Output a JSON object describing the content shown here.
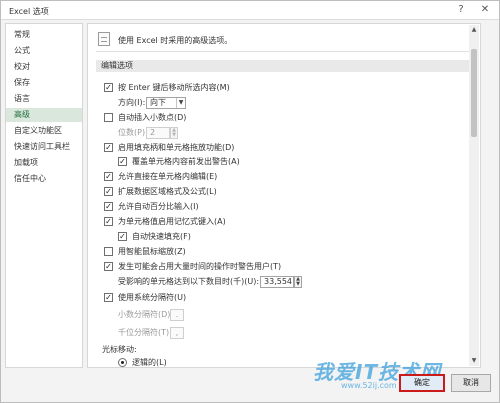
{
  "window": {
    "title": "Excel 选项",
    "help_label": "?",
    "close_label": "✕"
  },
  "sidebar": {
    "items": [
      {
        "label": "常规"
      },
      {
        "label": "公式"
      },
      {
        "label": "校对"
      },
      {
        "label": "保存"
      },
      {
        "label": "语言"
      },
      {
        "label": "高级"
      },
      {
        "label": "自定义功能区"
      },
      {
        "label": "快速访问工具栏"
      },
      {
        "label": "加载项"
      },
      {
        "label": "信任中心"
      }
    ],
    "active_index": 5
  },
  "content": {
    "header_text": "使用 Excel 时采用的高级选项。",
    "section_title": "编辑选项",
    "options": [
      {
        "label": "按 Enter 键后移动所选内容(M)",
        "checked": true,
        "enabled": true
      },
      {
        "label": "方向(I):",
        "enabled": true
      },
      {
        "label": "自动插入小数点(D)",
        "checked": false,
        "enabled": true
      },
      {
        "label": "位数(P):",
        "enabled": false
      },
      {
        "label": "启用填充柄和单元格拖放功能(D)",
        "checked": true,
        "enabled": true
      },
      {
        "label": "覆盖单元格内容前发出警告(A)",
        "checked": true,
        "enabled": true
      },
      {
        "label": "允许直接在单元格内编辑(E)",
        "checked": true,
        "enabled": true
      },
      {
        "label": "扩展数据区域格式及公式(L)",
        "checked": true,
        "enabled": true
      },
      {
        "label": "允许自动百分比输入(I)",
        "checked": true,
        "enabled": true
      },
      {
        "label": "为单元格值启用记忆式键入(A)",
        "checked": true,
        "enabled": true
      },
      {
        "label": "自动快速填充(F)",
        "checked": true,
        "enabled": true
      },
      {
        "label": "用智能鼠标缩放(Z)",
        "checked": false,
        "enabled": true
      },
      {
        "label": "发生可能会占用大量时间的操作时警告用户(T)",
        "checked": true,
        "enabled": true
      },
      {
        "label": "受影响的单元格达到以下数目时(千)(U):",
        "enabled": true
      },
      {
        "label": "使用系统分隔符(U)",
        "checked": true,
        "enabled": true
      },
      {
        "label": "小数分隔符(D):",
        "enabled": false
      },
      {
        "label": "千位分隔符(T):",
        "enabled": false
      },
      {
        "label": "光标移动:",
        "enabled": true
      },
      {
        "label": "逻辑的(L)",
        "enabled": true
      }
    ],
    "direction_value": "向下",
    "places_value": "2",
    "cells_threshold_value": "33,554",
    "decimal_separator_value": ".",
    "thousands_separator_value": ","
  },
  "buttons": {
    "ok_label": "确定",
    "cancel_label": "取消"
  },
  "watermark": {
    "text": "我爱IT技术网",
    "url": "www.52ij.com"
  },
  "colors": {
    "active_nav_bg": "#d9e7dd",
    "ok_highlight_border": "#cc1a1a"
  }
}
